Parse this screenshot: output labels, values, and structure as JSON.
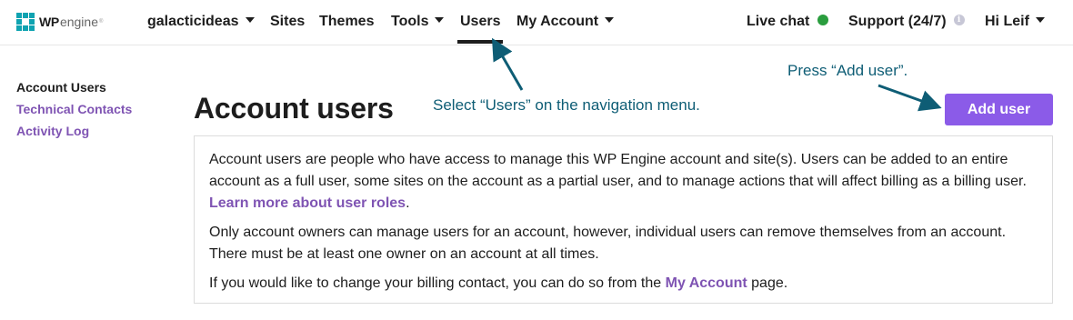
{
  "brand": {
    "wp": "WP",
    "engine": "engine",
    "tm": "®"
  },
  "nav": {
    "account": "galacticideas",
    "sites": "Sites",
    "themes": "Themes",
    "tools": "Tools",
    "users": "Users",
    "my_account": "My Account",
    "live_chat": "Live chat",
    "support": "Support (24/7)",
    "greeting": "Hi Leif"
  },
  "sidebar": {
    "items": [
      {
        "label": "Account Users"
      },
      {
        "label": "Technical Contacts"
      },
      {
        "label": "Activity Log"
      }
    ]
  },
  "main": {
    "title": "Account users",
    "add_user_label": "Add user",
    "p1_text": "Account users are people who have access to manage this WP Engine account and site(s). Users can be added to an entire account as a full user, some sites on the account as a partial user, and to manage actions that will affect billing as a billing user. ",
    "p1_link": "Learn more about user roles",
    "p1_end": ".",
    "p2_text": "Only account owners can manage users for an account, however, individual users can remove themselves from an account. There must be at least one owner on an account at all times.",
    "p3_text": "If you would like to change your billing contact, you can do so from the ",
    "p3_link": "My Account",
    "p3_end": " page."
  },
  "annotations": {
    "select_users": "Select “Users” on the navigation menu.",
    "press_add_user": "Press “Add user”."
  },
  "colors": {
    "accent": "#8b5be8",
    "link": "#7f54b3",
    "annotation": "#0e5d75",
    "online": "#2a9d3e",
    "brand": "#0fa3b1"
  }
}
